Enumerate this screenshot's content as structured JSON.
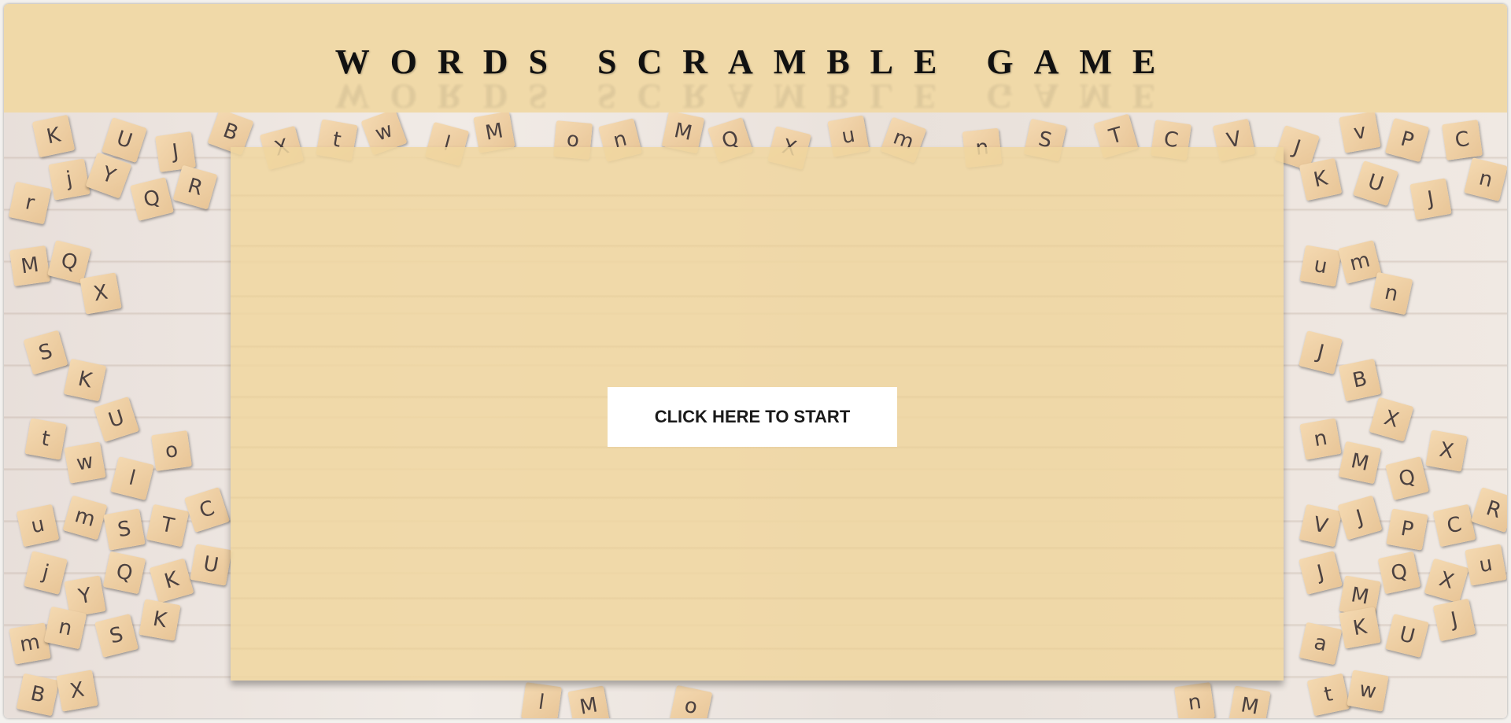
{
  "game": {
    "title": "WORDS SCRAMBLE GAME",
    "start_label": "CLICK HERE TO START"
  },
  "background": {
    "tile_letters": [
      "K",
      "U",
      "J",
      "B",
      "X",
      "t",
      "w",
      "l",
      "M",
      "o",
      "n",
      "M",
      "Q",
      "X",
      "u",
      "m",
      "n",
      "S",
      "T",
      "C",
      "V",
      "J",
      "v",
      "P",
      "C",
      "r",
      "j",
      "Y",
      "Q",
      "R",
      "K",
      "U",
      "J",
      "n",
      "M",
      "Q",
      "X",
      "u",
      "m",
      "n",
      "S",
      "K",
      "U",
      "J",
      "B",
      "X",
      "t",
      "w",
      "l",
      "o",
      "n",
      "M",
      "Q",
      "X",
      "u",
      "m",
      "S",
      "T",
      "C",
      "V",
      "J",
      "P",
      "C",
      "R",
      "j",
      "Y",
      "Q",
      "K",
      "U",
      "J",
      "M",
      "Q",
      "X",
      "u",
      "m",
      "n",
      "S",
      "K",
      "a"
    ]
  },
  "colors": {
    "header_bg": "#f0d9a8",
    "panel_bg": "rgba(240,214,160,0.86)",
    "button_bg": "#ffffff"
  }
}
